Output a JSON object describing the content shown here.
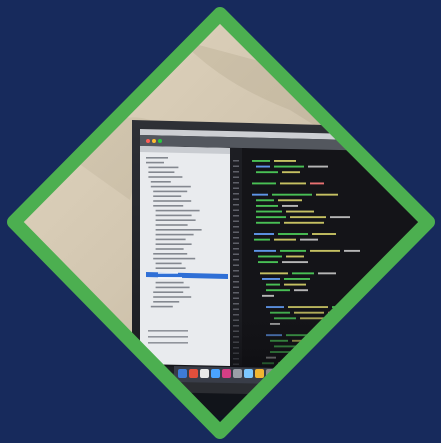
{
  "colors": {
    "background": "#172a5c",
    "frame": "#4caf50",
    "wall": "#d8cdb8",
    "wall_shadow": "#b7a98f",
    "laptop_body": "#2a2c31",
    "screen_bg": "#141418",
    "sidebar_bg": "#e9ebee",
    "selection": "#2f6fd6",
    "code_green": "#4fd35c",
    "code_yellow": "#d8d36a",
    "code_blue": "#66a3ff",
    "code_red": "#ff7b7b",
    "dock": "#3b3f4a"
  },
  "icons": [
    "diamond-frame",
    "laptop-icon",
    "code-editor-icon",
    "file-tree-icon",
    "dock-icon"
  ]
}
